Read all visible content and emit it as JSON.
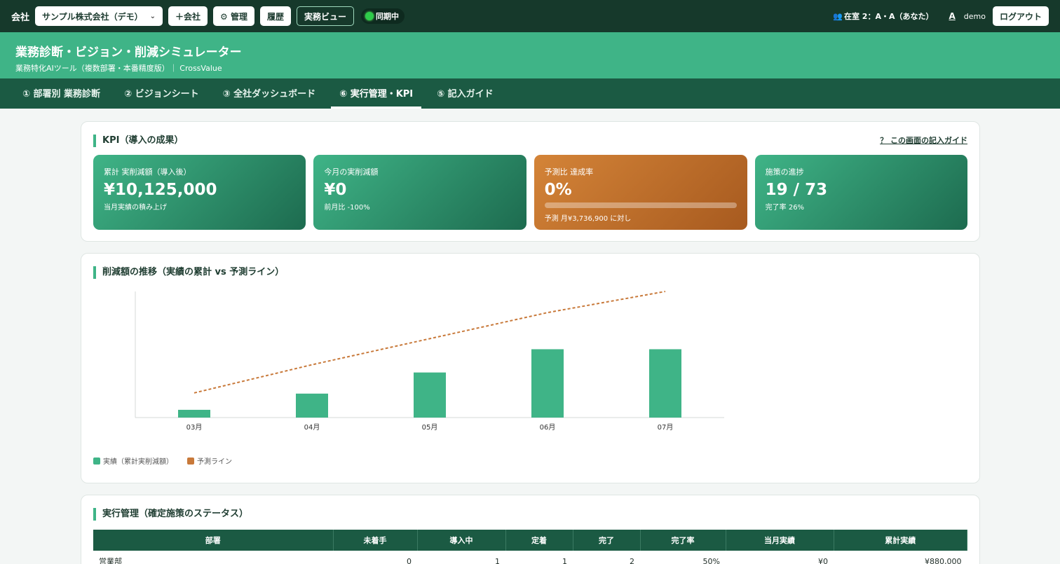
{
  "topbar": {
    "company_label": "会社",
    "company_selected": "サンプル株式会社（デモ）",
    "add_company": "＋会社",
    "admin": "⚙ 管理",
    "history": "履歴",
    "work_view": "実務ビュー",
    "sync_status": "同期中",
    "presence": "在室 2：A・A（あなた）",
    "avatar": "A",
    "user": "demo",
    "logout": "ログアウト"
  },
  "header": {
    "title": "業務診断・ビジョン・削減シミュレーター",
    "subtitle": "業務特化AIツール（複数部署・本番精度版）｜ CrossValue"
  },
  "tabs": [
    {
      "label": "① 部署別 業務診断"
    },
    {
      "label": "② ビジョンシート"
    },
    {
      "label": "③ 全社ダッシュボード"
    },
    {
      "label": "⑥ 実行管理・KPI"
    },
    {
      "label": "⑤ 記入ガイド"
    }
  ],
  "kpi_section": {
    "title": "KPI（導入の成果）",
    "guide_link": "？ この画面の記入ガイド",
    "cards": [
      {
        "label": "累計 実削減額（導入後）",
        "value": "¥10,125,000",
        "note": "当月実績の積み上げ"
      },
      {
        "label": "今月の実削減額",
        "value": "¥0",
        "note": "前月比 -100%"
      },
      {
        "label": "予測比 達成率",
        "value": "0%",
        "note": "予測 月¥3,736,900 に対し",
        "progress": 0
      },
      {
        "label": "施策の進捗",
        "value": "19 / 73",
        "note": "完了率 26%"
      }
    ]
  },
  "chart_section": {
    "title": "削減額の推移（実績の累計 vs 予測ライン）",
    "legend_actual": "実績（累計実削減額）",
    "legend_forecast": "予測ライン"
  },
  "chart_data": {
    "type": "bar",
    "categories": [
      "03月",
      "04月",
      "05月",
      "06月",
      "07月"
    ],
    "series": [
      {
        "name": "実績（累計実削減額）",
        "kind": "bar",
        "color": "#3fb487",
        "values": [
          1.1,
          3.4,
          6.4,
          9.7,
          9.7
        ]
      },
      {
        "name": "予測ライン",
        "kind": "line",
        "style": "dashed",
        "color": "#c8793a",
        "values": [
          3.5,
          7.5,
          11.2,
          14.9,
          17.9
        ]
      }
    ],
    "ylim": [
      0,
      17.9
    ],
    "grid": false,
    "legend": "bottom-left"
  },
  "execution": {
    "title": "実行管理（確定施策のステータス）",
    "columns": [
      "部署",
      "未着手",
      "導入中",
      "定着",
      "完了",
      "完了率",
      "当月実績",
      "累計実績"
    ],
    "rows": [
      [
        "営業部",
        "0",
        "1",
        "1",
        "2",
        "50%",
        "¥0",
        "¥880,000"
      ]
    ]
  },
  "colors": {
    "primary": "#3fb487",
    "dark": "#16392b",
    "tab_bg": "#1b5a43",
    "orange": "#c8793a"
  }
}
